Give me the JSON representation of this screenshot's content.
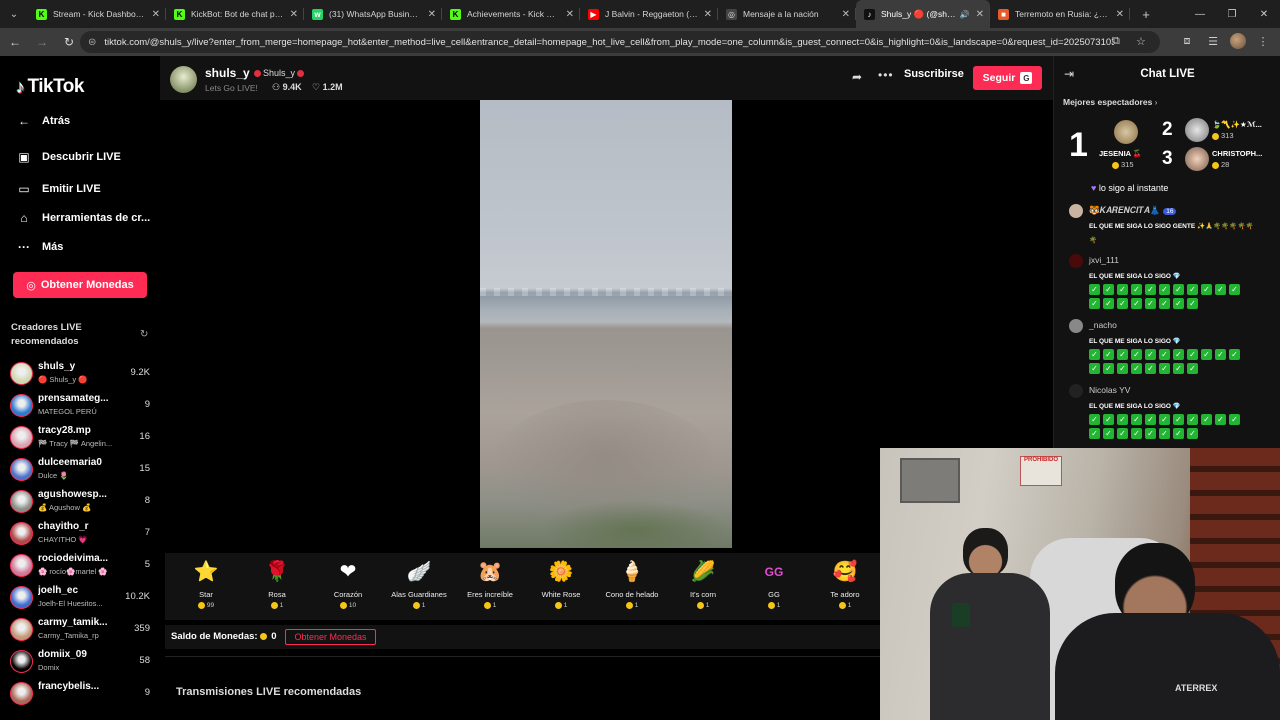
{
  "browser": {
    "tabs": [
      {
        "title": "Stream - Kick Dashboard",
        "fav": "K",
        "favColor": "#53fc18",
        "favText": "#000"
      },
      {
        "title": "KickBot: Bot de chat pers...",
        "fav": "K",
        "favColor": "#53fc18",
        "favText": "#000"
      },
      {
        "title": "(31) WhatsApp Business",
        "fav": "w",
        "favColor": "#25d366",
        "favText": "#fff"
      },
      {
        "title": "Achievements - Kick Dash...",
        "fav": "K",
        "favColor": "#53fc18",
        "favText": "#000"
      },
      {
        "title": "J Balvin - Reggaeton (Offi...",
        "fav": "▶",
        "favColor": "#ff0000",
        "favText": "#fff"
      },
      {
        "title": "Mensaje a la nación",
        "fav": "◎",
        "favColor": "#444",
        "favText": "#ddd"
      },
      {
        "title": "Shuls_y 🔴 (@shul...",
        "fav": "♪",
        "favColor": "#111",
        "favText": "#fff"
      },
      {
        "title": "Terremoto en Rusia: ¿A q...",
        "fav": "■",
        "favColor": "#e65b2a",
        "favText": "#fff"
      }
    ],
    "active_tab": 6,
    "url": "tiktok.com/@shuls_y/live?enter_from_merge=homepage_hot&enter_method=live_cell&entrance_detail=homepage_hot_live_cell&from_play_mode=one_column&is_guest_connect=0&is_highlight=0&is_landscape=0&request_id=202507310340..."
  },
  "sidebar": {
    "logo_text": "TikTok",
    "nav": [
      {
        "label": "Atrás",
        "icon": "back-arrow-icon",
        "glyph": "←"
      },
      {
        "label": "Descubrir LIVE",
        "icon": "live-tv-icon",
        "glyph": "▣"
      },
      {
        "label": "Emitir LIVE",
        "icon": "camera-icon",
        "glyph": "▭"
      },
      {
        "label": "Herramientas de cr...",
        "icon": "home-icon",
        "glyph": "⌂"
      },
      {
        "label": "Más",
        "icon": "more-icon",
        "glyph": "···"
      }
    ],
    "coins_button": "Obtener Monedas",
    "recommended_title": "Creadores LIVE recomendados",
    "creators": [
      {
        "name": "shuls_y",
        "sub": "🔴 Shuls_y 🔴",
        "count": "9.2K",
        "color": "#cfd8b0"
      },
      {
        "name": "prensamateg...",
        "sub": "MATEGOL PERÚ",
        "count": "9",
        "color": "#2a7bd1"
      },
      {
        "name": "tracy28.mp",
        "sub": "🏁 Tracy 🏁 Angelin...",
        "count": "16",
        "color": "#d9a4b0"
      },
      {
        "name": "dulceemaria0",
        "sub": "Dulce 🌷",
        "count": "15",
        "color": "#4a73c9"
      },
      {
        "name": "agushowesp...",
        "sub": "💰 Agushow 💰",
        "count": "8",
        "color": "#8a8f86"
      },
      {
        "name": "chayitho_r",
        "sub": "CHAYITHO 💗",
        "count": "7",
        "color": "#b04949"
      },
      {
        "name": "rociodeivima...",
        "sub": "🌸 rocío🌸martel 🌸",
        "count": "5",
        "color": "#d07a9a"
      },
      {
        "name": "joelh_ec",
        "sub": "Joelh-El Huesitos...",
        "count": "10.2K",
        "color": "#3b6ccf"
      },
      {
        "name": "carmy_tamik...",
        "sub": "Carmy_Tamika_rp",
        "count": "359",
        "color": "#c29a7a"
      },
      {
        "name": "domiix_09",
        "sub": "Domix",
        "count": "58",
        "color": "#000"
      },
      {
        "name": "francybelis...",
        "sub": "",
        "count": "9",
        "color": "#a86a5a"
      }
    ]
  },
  "stream": {
    "streamer_name": "shuls_y",
    "streamer_nick": "Shuls_y",
    "title": "Lets Go LIVE!",
    "viewers": "9.4K",
    "likes": "1.2M",
    "subscribe": "Suscribirse",
    "follow": "Seguir",
    "follow_key": "G"
  },
  "gifts": [
    {
      "name": "Star",
      "cost": "99",
      "glyph": "⭐",
      "icon": "star-gift-icon"
    },
    {
      "name": "Rosa",
      "cost": "1",
      "glyph": "🌹",
      "icon": "rose-gift-icon"
    },
    {
      "name": "Corazón",
      "cost": "10",
      "glyph": "❤",
      "icon": "heart-gift-icon"
    },
    {
      "name": "Alas Guardianes",
      "cost": "1",
      "glyph": "🪽",
      "icon": "wings-gift-icon"
    },
    {
      "name": "Eres increíble",
      "cost": "1",
      "glyph": "🐹",
      "icon": "hamster-gift-icon"
    },
    {
      "name": "White Rose",
      "cost": "1",
      "glyph": "🌼",
      "icon": "white-rose-gift-icon"
    },
    {
      "name": "Cono de helado",
      "cost": "1",
      "glyph": "🍦",
      "icon": "ice-cream-gift-icon"
    },
    {
      "name": "It's corn",
      "cost": "1",
      "glyph": "🌽",
      "icon": "corn-gift-icon"
    },
    {
      "name": "GG",
      "cost": "1",
      "glyph": "GG",
      "icon": "gg-gift-icon"
    },
    {
      "name": "Te adoro",
      "cost": "1",
      "glyph": "🥰",
      "icon": "adore-gift-icon"
    }
  ],
  "balance": {
    "label": "Saldo de Monedas:",
    "value": "0",
    "button": "Obtener Monedas"
  },
  "more_title": "Transmisiones LIVE recomendadas",
  "chat": {
    "title": "Chat LIVE",
    "top_viewers_label": "Mejores espectadores",
    "top": [
      {
        "rank": "1",
        "name": "JESENIA 🍒",
        "coins": "315"
      },
      {
        "rank": "2",
        "name": "🍃〽️✨★ℳ...",
        "coins": "313"
      },
      {
        "rank": "3",
        "name": "CHRISTOPH...",
        "coins": "28"
      }
    ],
    "pinned": "lo sigo al instante",
    "messages": [
      {
        "user": "🐯𝑲𝑨𝑹𝑬𝑵𝑪𝑰𝑻𝑨👗",
        "badge": "16",
        "text": "EL QUE ME SIGA LO SIGO GENTE ✨🙏🌴🌴🌴🌴🌴🌴",
        "checks": 0,
        "color": "#c9b3a1"
      },
      {
        "user": "jxvi_111",
        "badge": "",
        "text": "EL QUE ME SIGA LO SIGO 💎",
        "checks": 19,
        "color": "#4a0a0a"
      },
      {
        "user": "_nacho",
        "badge": "",
        "text": "EL QUE ME SIGA LO SIGO 💎",
        "checks": 19,
        "color": "#888"
      },
      {
        "user": "Nicolas YV",
        "badge": "",
        "text": "EL QUE ME SIGA LO SIGO 💎",
        "checks": 19,
        "color": "#222"
      }
    ]
  },
  "webcam": {
    "sign_text": "PROHIBIDO",
    "shirt_text": "ATERREX"
  }
}
